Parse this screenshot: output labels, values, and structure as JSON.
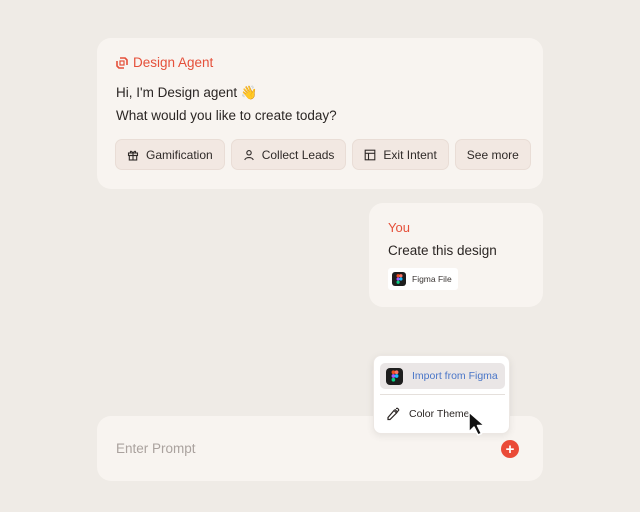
{
  "agent": {
    "name": "Design Agent",
    "greeting_line1": "Hi, I'm Design agent 👋",
    "greeting_line2": "What would you like to create today?",
    "chips": [
      {
        "label": "Gamification",
        "icon": "gift-icon"
      },
      {
        "label": "Collect Leads",
        "icon": "user-icon"
      },
      {
        "label": "Exit Intent",
        "icon": "layout-icon"
      },
      {
        "label": "See more"
      }
    ]
  },
  "user_message": {
    "author": "You",
    "text": "Create this design",
    "attachment": {
      "label": "Figma File",
      "icon": "figma-icon"
    }
  },
  "dropdown": {
    "items": [
      {
        "label": "Import from Figma",
        "icon": "figma-icon",
        "active": true
      },
      {
        "label": "Color Theme",
        "icon": "eyedropper-icon"
      }
    ]
  },
  "prompt": {
    "placeholder": "Enter Prompt",
    "add_button_icon": "plus-icon"
  },
  "colors": {
    "accent": "#e5503a",
    "background": "#efebe6",
    "card": "#f8f4f0",
    "link_blue": "#4a76c8"
  }
}
